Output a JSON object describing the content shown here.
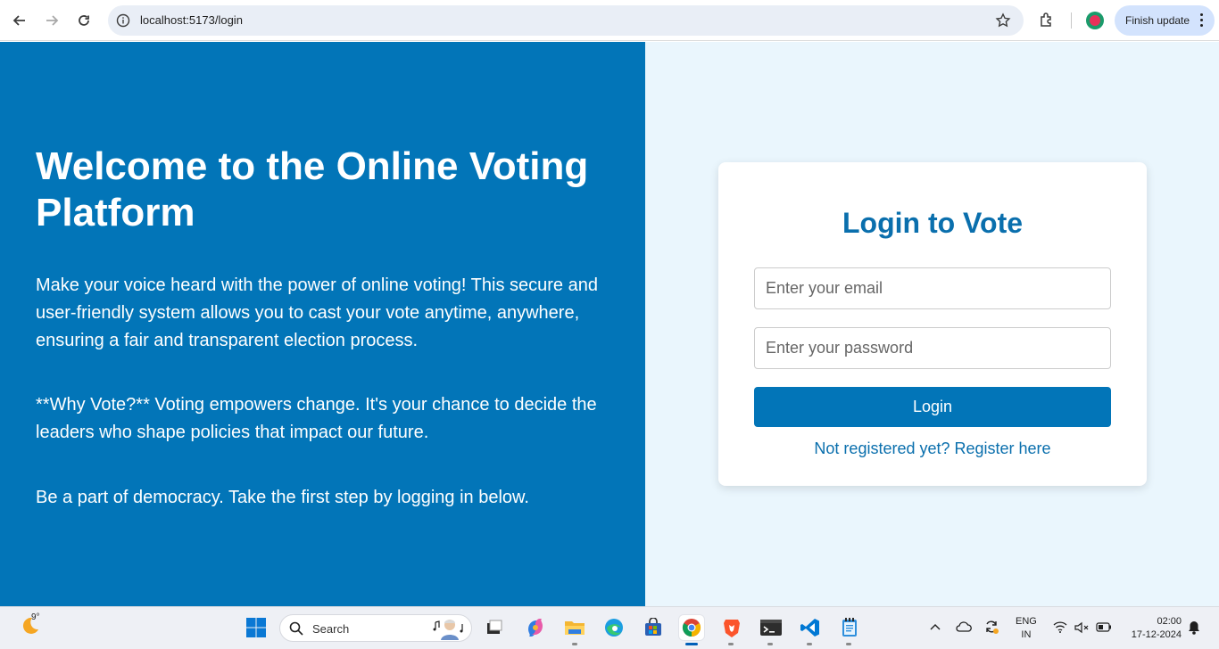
{
  "browser": {
    "url": "localhost:5173/login",
    "update_label": "Finish update"
  },
  "hero": {
    "title": "Welcome to the Online Voting Platform",
    "paragraph1": "Make your voice heard with the power of online voting! This secure and user-friendly system allows you to cast your vote anytime, anywhere, ensuring a fair and transparent election process.",
    "paragraph2": "**Why Vote?** Voting empowers change. It's your chance to decide the leaders who shape policies that impact our future.",
    "paragraph3": "Be a part of democracy. Take the first step by logging in below."
  },
  "login": {
    "title": "Login to Vote",
    "email_placeholder": "Enter your email",
    "password_placeholder": "Enter your password",
    "button_label": "Login",
    "register_link": "Not registered yet? Register here"
  },
  "taskbar": {
    "weather_temp": "9°",
    "search_label": "Search",
    "lang_primary": "ENG",
    "lang_secondary": "IN",
    "time": "02:00",
    "date": "17-12-2024"
  },
  "colors": {
    "brand": "#0275b8",
    "heading": "#0a6fad",
    "right_bg": "#eaf6fd"
  }
}
